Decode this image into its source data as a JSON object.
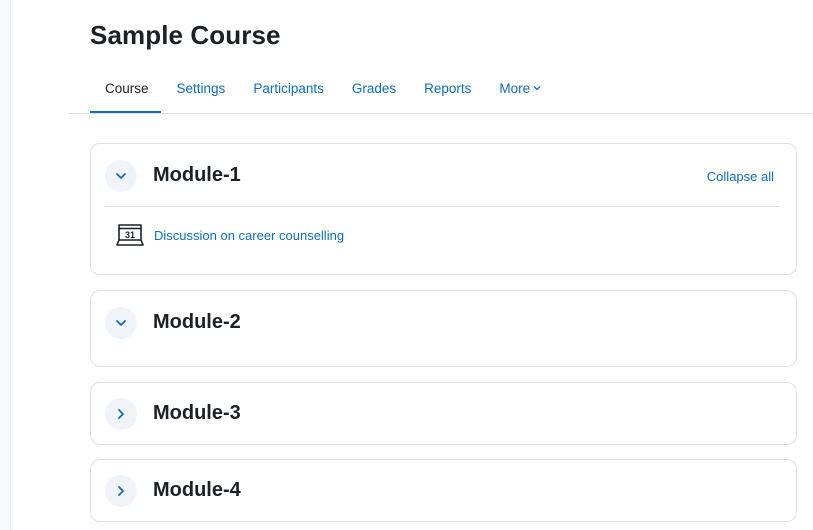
{
  "course": {
    "title": "Sample Course"
  },
  "nav": {
    "items": [
      {
        "label": "Course",
        "active": true
      },
      {
        "label": "Settings",
        "active": false
      },
      {
        "label": "Participants",
        "active": false
      },
      {
        "label": "Grades",
        "active": false
      },
      {
        "label": "Reports",
        "active": false
      },
      {
        "label": "More",
        "active": false
      }
    ],
    "more_chevron": "chevron-down-icon"
  },
  "sections": [
    {
      "title": "Module-1",
      "expanded": true,
      "collapse_all_label": "Collapse all",
      "activities": [
        {
          "icon": "calendar-icon",
          "icon_text": "31",
          "label": "Discussion on career counselling"
        }
      ]
    },
    {
      "title": "Module-2",
      "expanded": true,
      "activities": []
    },
    {
      "title": "Module-3",
      "expanded": false,
      "activities": []
    },
    {
      "title": "Module-4",
      "expanded": false,
      "activities": []
    }
  ],
  "colors": {
    "accent": "#0f6cbf",
    "text": "#1d2125",
    "border": "#dee2e6",
    "toggle_bg": "#f0f4f9"
  }
}
